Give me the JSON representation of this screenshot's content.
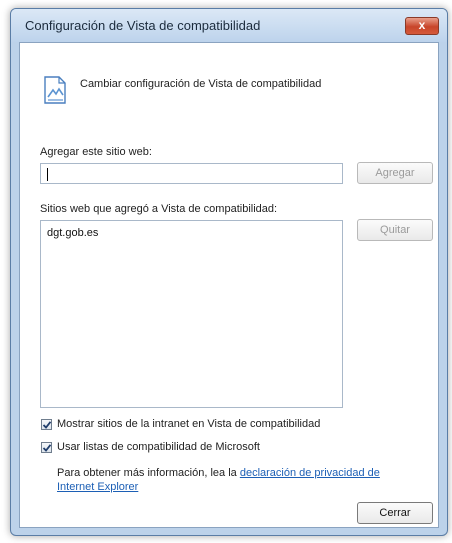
{
  "window": {
    "title": "Configuración de Vista de compatibilidad",
    "close_label": "x"
  },
  "header": {
    "text": "Cambiar configuración de Vista de compatibilidad",
    "icon": "compatibility-view-icon"
  },
  "add_site": {
    "label": "Agregar este sitio web:",
    "input_value": "",
    "button_label": "Agregar"
  },
  "sites": {
    "label": "Sitios web que agregó a Vista de compatibilidad:",
    "items": [
      "dgt.gob.es"
    ],
    "remove_label": "Quitar"
  },
  "options": {
    "intranet_label": "Mostrar sitios de la intranet en Vista de compatibilidad",
    "intranet_checked": true,
    "ms_lists_label": "Usar listas de compatibilidad de Microsoft",
    "ms_lists_checked": true
  },
  "info": {
    "text": "Para obtener más información, lea la",
    "link_part1": "declaración de privacidad de",
    "link_part2": "Internet Explorer"
  },
  "footer": {
    "close_label": "Cerrar"
  },
  "colors": {
    "frame": "#bcd2ea",
    "close_button": "#c8452a",
    "link": "#1c5fb5"
  }
}
